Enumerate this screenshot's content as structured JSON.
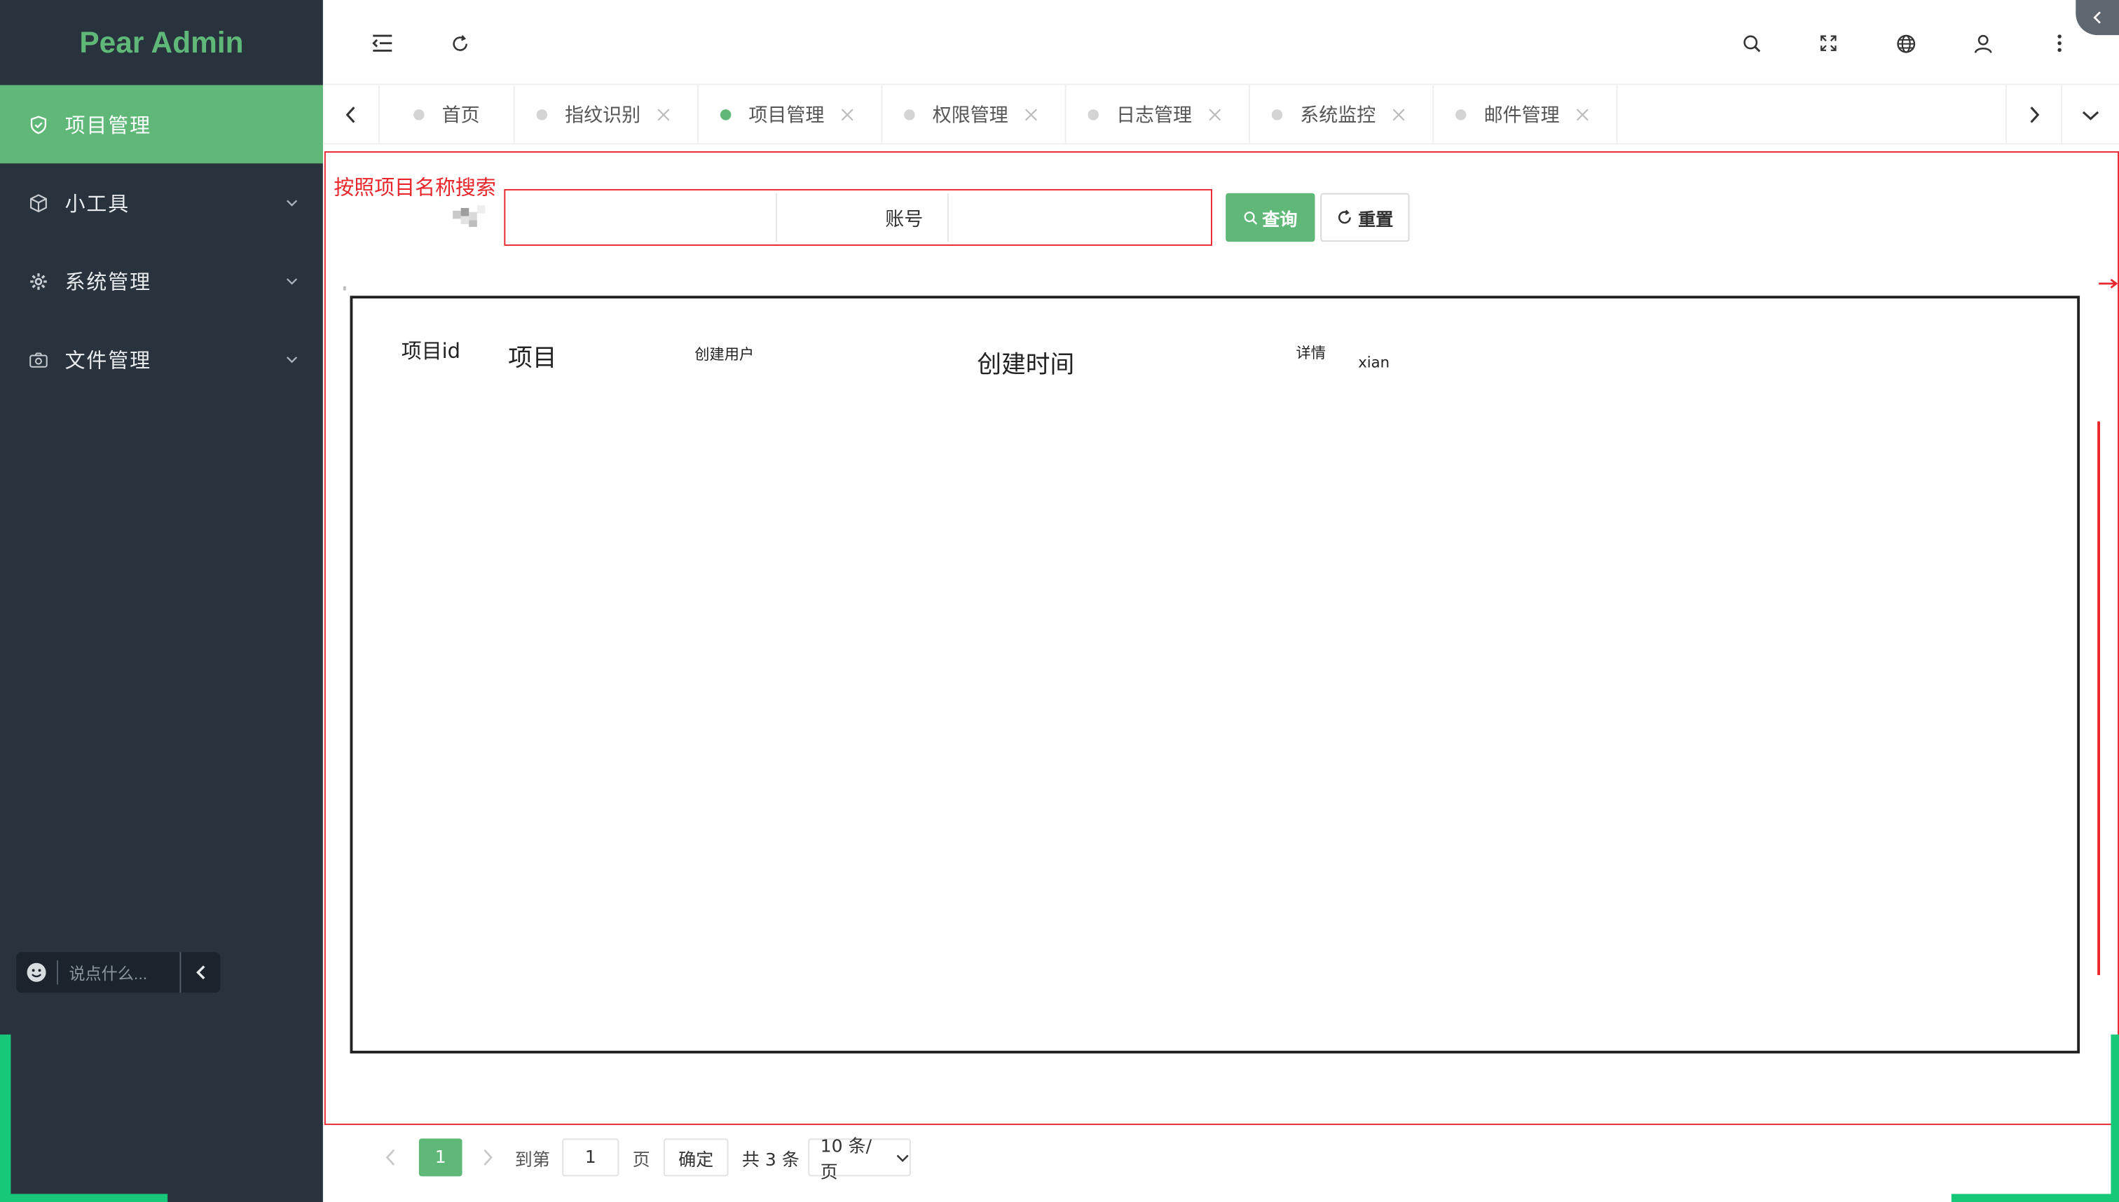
{
  "app": {
    "brand": "Pear Admin"
  },
  "sidebar": {
    "items": [
      {
        "label": "项目管理",
        "icon": "shield-check-icon",
        "active": true
      },
      {
        "label": "小工具",
        "icon": "cube-icon",
        "expandable": true
      },
      {
        "label": "系统管理",
        "icon": "gear-icon",
        "expandable": true
      },
      {
        "label": "文件管理",
        "icon": "camera-icon",
        "expandable": true
      }
    ],
    "chat": {
      "placeholder": "说点什么..."
    }
  },
  "header": {
    "icons": [
      "menu-fold-icon",
      "refresh-icon",
      "search-icon",
      "fullscreen-icon",
      "globe-icon",
      "user-icon",
      "more-icon"
    ]
  },
  "tabs": [
    {
      "label": "首页",
      "closable": false
    },
    {
      "label": "指纹识别",
      "closable": true
    },
    {
      "label": "项目管理",
      "closable": true,
      "active": true
    },
    {
      "label": "权限管理",
      "closable": true
    },
    {
      "label": "日志管理",
      "closable": true
    },
    {
      "label": "系统监控",
      "closable": true
    },
    {
      "label": "邮件管理",
      "closable": true
    }
  ],
  "search": {
    "annotation": "按照项目名称搜索",
    "account_label": "账号",
    "query_label": "查询",
    "reset_label": "重置"
  },
  "table": {
    "headers": [
      "项目id",
      "项目",
      "创建用户",
      "创建时间",
      "详情",
      "xian"
    ]
  },
  "pagination": {
    "current_page": "1",
    "goto_label": "到第",
    "goto_value": "1",
    "page_unit": "页",
    "confirm_label": "确定",
    "total_label": "共 3 条",
    "page_size": "10 条/页"
  },
  "colors": {
    "accent": "#5fb878",
    "sidebar_bg": "#28333e",
    "annotation_red": "#e8262c",
    "edge_green": "#18c87a"
  }
}
